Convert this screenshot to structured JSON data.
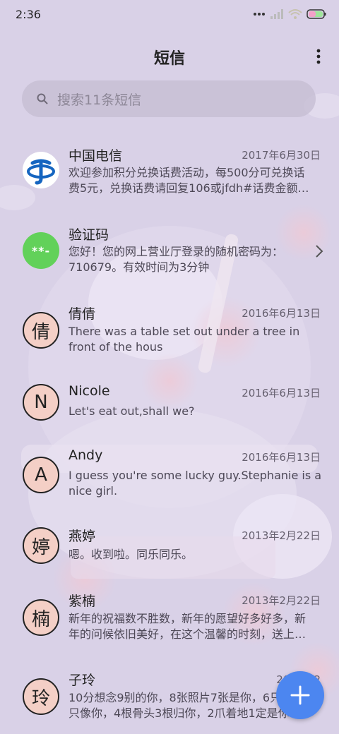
{
  "status_bar": {
    "time": "2:36"
  },
  "header": {
    "title": "短信"
  },
  "search": {
    "placeholder": "搜索11条短信"
  },
  "conversations": [
    {
      "name": "中国电信",
      "date": "2017年6月30日",
      "avatar": "",
      "avatar_type": "telecom-logo",
      "preview_line1": "欢迎参加积分兑换话费活动，每500分可兑换话",
      "preview_line2": "费5元，兑换话费请回复106或jfdh#话费金额…"
    },
    {
      "name": "验证码",
      "date": "",
      "avatar": "**-",
      "avatar_type": "green",
      "preview_line1": "您好！您的网上营业厅登录的随机密码为：",
      "preview_line2": "710679。有效时间为3分钟"
    },
    {
      "name": "倩倩",
      "date": "2016年6月13日",
      "avatar": "倩",
      "avatar_type": "letter",
      "preview_line1": "There was a table set out under a tree in",
      "preview_line2": "front of the hous"
    },
    {
      "name": "Nicole",
      "date": "2016年6月13日",
      "avatar": "N",
      "avatar_type": "letter",
      "preview_line1": "Let's eat out,shall we?",
      "preview_line2": ""
    },
    {
      "name": "Andy",
      "date": "2016年6月13日",
      "avatar": "A",
      "avatar_type": "letter",
      "preview_line1": "I guess you're some lucky guy.Stephanie is a",
      "preview_line2": "nice girl."
    },
    {
      "name": "燕婷",
      "date": "2013年2月22日",
      "avatar": "婷",
      "avatar_type": "letter",
      "preview_line1": "嗯。收到啦。同乐同乐。",
      "preview_line2": ""
    },
    {
      "name": "紫楠",
      "date": "2013年2月22日",
      "avatar": "楠",
      "avatar_type": "letter",
      "preview_line1": "新年的祝福数不胜数，新年的愿望好多好多，新",
      "preview_line2": "年的问候依旧美好，在这个温馨的时刻，送上…"
    },
    {
      "name": "子玲",
      "date": "2013年2",
      "avatar": "玲",
      "avatar_type": "letter",
      "preview_line1": "10分想念9别的你，8张照片7张是你，6只",
      "preview_line2": "只像你，4根骨头3根归你，2爪着地1定是你"
    }
  ],
  "colors": {
    "background": "#d8d0e6",
    "avatar_fill": "#f4cfc6",
    "fab": "#4c86f0",
    "green_avatar": "#62d15a",
    "telecom_blue": "#1565c0"
  },
  "icons": {
    "more": "more-vertical-icon",
    "search": "search-icon",
    "fab": "plus-icon",
    "chevron": "chevron-right-icon"
  }
}
